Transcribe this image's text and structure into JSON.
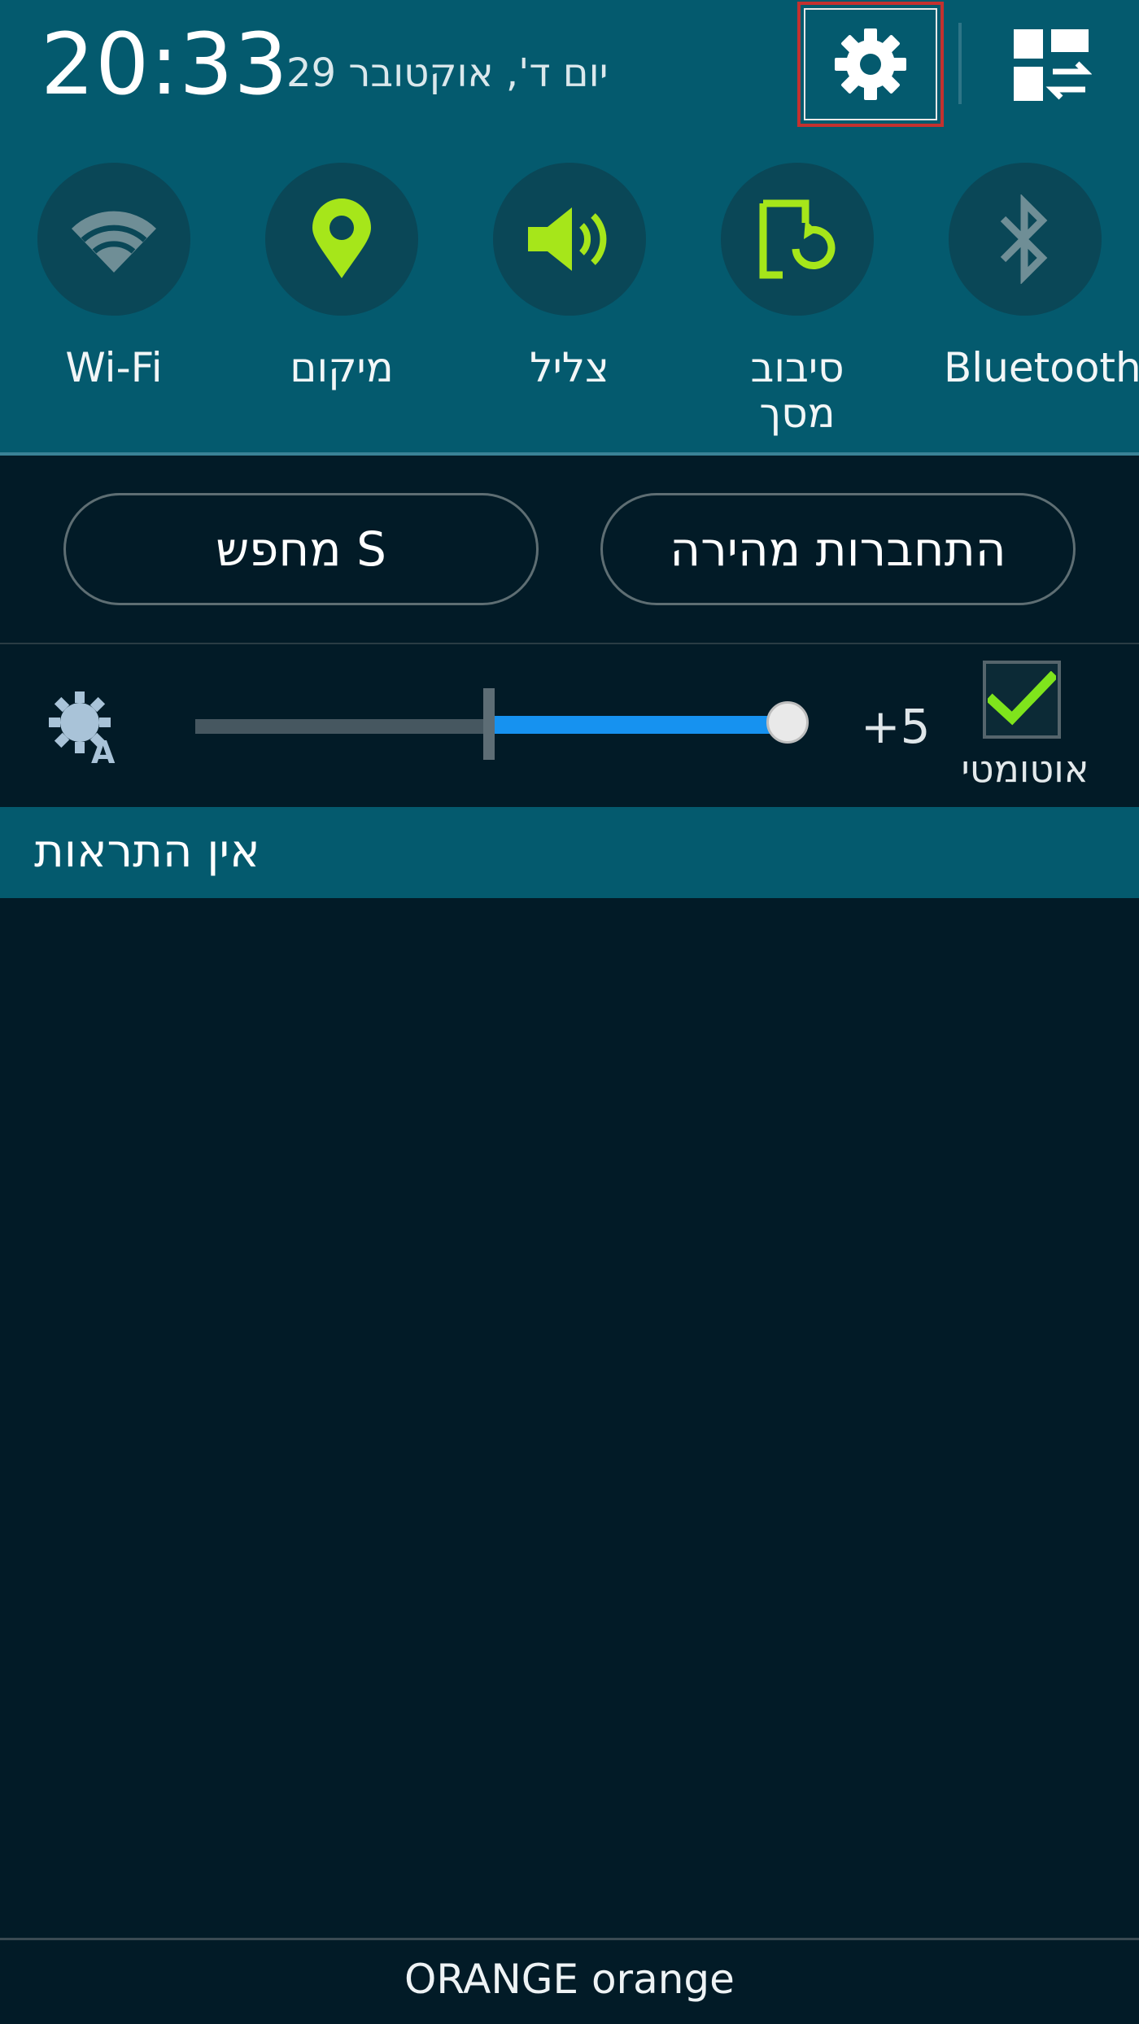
{
  "status": {
    "time": "20:33",
    "date": "יום ד', אוקטובר 29"
  },
  "header_icons": {
    "settings": "gear-icon",
    "edit_toggles": "grid-swap-icon"
  },
  "quick_toggles": [
    {
      "label": "Wi-Fi",
      "icon": "wifi-icon",
      "active": false
    },
    {
      "label": "מיקום",
      "icon": "location-pin-icon",
      "active": true
    },
    {
      "label": "צליל",
      "icon": "speaker-icon",
      "active": true
    },
    {
      "label": "סיבוב\nמסך",
      "icon": "screen-rotation-icon",
      "active": true
    },
    {
      "label": "Bluetooth",
      "icon": "bluetooth-icon",
      "active": false
    }
  ],
  "buttons": {
    "s_finder": "מחפש S",
    "quick_connect": "התחברות מהירה"
  },
  "brightness": {
    "level_label": "+5",
    "auto_label": "אוטומטי",
    "auto_checked": true,
    "slider_fraction": 0.97
  },
  "notifications": {
    "empty_text": "אין התראות"
  },
  "footer": {
    "carrier": "ORANGE orange"
  },
  "colors": {
    "header_bg": "#045a6e",
    "panel_bg": "#021b27",
    "active_green": "#a6e61a",
    "inactive_gray": "#6f8e96",
    "slider_blue": "#1692f0"
  }
}
